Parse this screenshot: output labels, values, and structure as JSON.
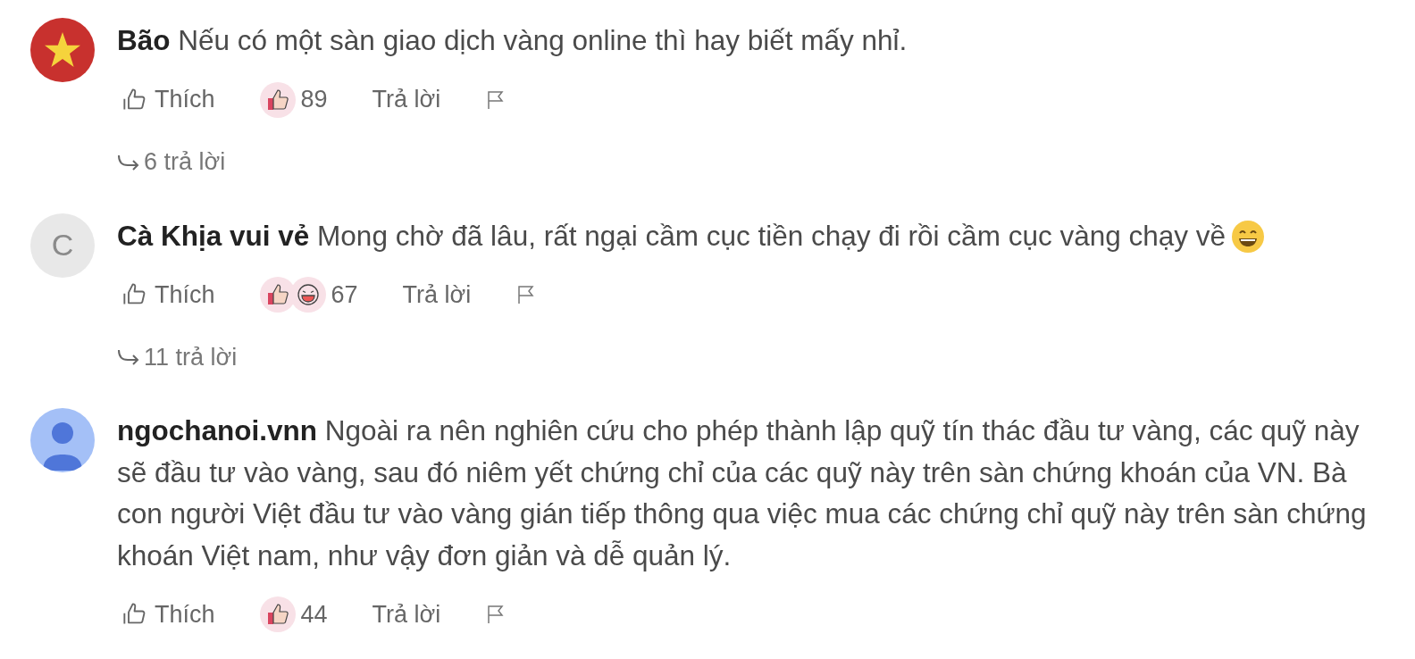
{
  "comments": [
    {
      "avatar": {
        "kind": "flag"
      },
      "name": "Bão",
      "text": "Nếu có một sàn giao dịch vàng online thì hay biết mấy nhỉ.",
      "like_label": "Thích",
      "reactions": [
        {
          "kind": "like"
        }
      ],
      "count": "89",
      "reply_label": "Trả lời",
      "replies": "6 trả lời"
    },
    {
      "avatar": {
        "kind": "letter",
        "letter": "C"
      },
      "name": "Cà Khịa vui vẻ",
      "text": "Mong chờ đã lâu, rất ngại cầm cục tiền chạy đi rồi cầm cục vàng chạy về",
      "smiley_emoji": true,
      "like_label": "Thích",
      "reactions": [
        {
          "kind": "like"
        },
        {
          "kind": "haha"
        }
      ],
      "count": "67",
      "reply_label": "Trả lời",
      "replies": "11 trả lời"
    },
    {
      "avatar": {
        "kind": "person"
      },
      "name": "ngochanoi.vnn",
      "text": "Ngoài ra nên nghiên cứu cho phép thành lập quỹ tín thác đầu tư vàng, các quỹ này sẽ đầu tư vào vàng, sau đó niêm yết chứng chỉ của các quỹ này trên sàn chứng khoán của VN. Bà con người Việt đầu tư vào vàng gián tiếp thông qua việc mua các chứng chỉ quỹ này trên sàn chứng khoán Việt nam, như vậy đơn giản và dễ quản lý.",
      "like_label": "Thích",
      "reactions": [
        {
          "kind": "like"
        }
      ],
      "count": "44",
      "reply_label": "Trả lời"
    }
  ]
}
